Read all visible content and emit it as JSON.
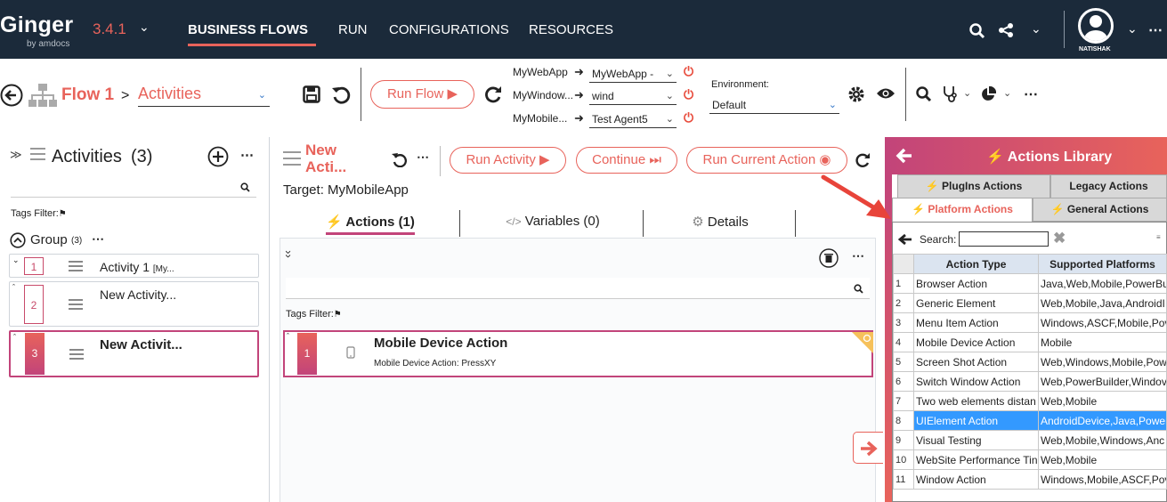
{
  "app": {
    "name": "Ginger",
    "by": "by amdocs",
    "version": "3.4.1"
  },
  "nav": {
    "items": [
      "BUSINESS FLOWS",
      "RUN",
      "CONFIGURATIONS",
      "RESOURCES"
    ],
    "user": "NATISHAK"
  },
  "flowbar": {
    "flow_name": "Flow 1",
    "separator": ">",
    "view": "Activities",
    "run_flow": "Run Flow",
    "agents": [
      {
        "app": "MyWebApp",
        "agent": "MyWebApp -"
      },
      {
        "app": "MyWindow...",
        "agent": "wind"
      },
      {
        "app": "MyMobile...",
        "agent": "Test Agent5"
      }
    ],
    "env_label": "Environment:",
    "env_value": "Default"
  },
  "activities": {
    "title": "Activities",
    "count": "(3)",
    "tags_filter": "Tags Filter:",
    "group_name": "Group",
    "group_count": "(3)",
    "items": [
      {
        "num": "1",
        "name": "Activity 1",
        "sub": "[My..."
      },
      {
        "num": "2",
        "name": "New Activity...",
        "sub": ""
      },
      {
        "num": "3",
        "name": "New Activit...",
        "sub": ""
      }
    ]
  },
  "activity": {
    "title_line1": "New",
    "title_line2": "Acti...",
    "run_activity": "Run Activity",
    "continue": "Continue",
    "run_current": "Run Current Action",
    "target": "Target: MyMobileApp",
    "tabs": [
      "Actions (1)",
      "Variables (0)",
      "Details"
    ],
    "tags_filter": "Tags Filter:",
    "action": {
      "num": "1",
      "title": "Mobile Device Action",
      "sub": "Mobile Device Action: PressXY"
    }
  },
  "library": {
    "title": "Actions Library",
    "tabs": [
      "PlugIns Actions",
      "Legacy Actions",
      "Platform Actions",
      "General Actions"
    ],
    "search_label": "Search:",
    "columns": [
      "Action Type",
      "Supported Platforms"
    ],
    "rows": [
      {
        "n": "1",
        "type": "Browser Action",
        "platforms": "Java,Web,Mobile,PowerBu"
      },
      {
        "n": "2",
        "type": "Generic Element",
        "platforms": "Web,Mobile,Java,AndroidI"
      },
      {
        "n": "3",
        "type": "Menu Item Action",
        "platforms": "Windows,ASCF,Mobile,Pov"
      },
      {
        "n": "4",
        "type": "Mobile Device Action",
        "platforms": "Mobile"
      },
      {
        "n": "5",
        "type": "Screen Shot Action",
        "platforms": "Web,Windows,Mobile,Pow"
      },
      {
        "n": "6",
        "type": "Switch Window Action",
        "platforms": "Web,PowerBuilder,Windov"
      },
      {
        "n": "7",
        "type": "Two web elements distan",
        "platforms": "Web,Mobile"
      },
      {
        "n": "8",
        "type": "UIElement Action",
        "platforms": "AndroidDevice,Java,Power"
      },
      {
        "n": "9",
        "type": "Visual Testing",
        "platforms": "Web,Mobile,Windows,Anc"
      },
      {
        "n": "10",
        "type": "WebSite Performance Tin",
        "platforms": "Web,Mobile"
      },
      {
        "n": "11",
        "type": "Window Action",
        "platforms": "Windows,Mobile,ASCF,Pov"
      }
    ],
    "selected_row": "8"
  },
  "colors": {
    "accent": "#e8635b",
    "accent2": "#c2447a",
    "topbar": "#1b2a3a",
    "selection": "#3399ff"
  }
}
